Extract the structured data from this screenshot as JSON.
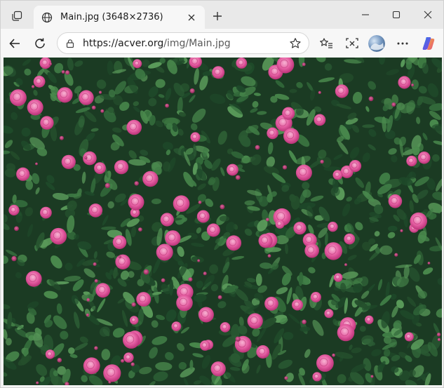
{
  "window": {
    "tab": {
      "title": "Main.jpg (3648×2736)"
    },
    "address": {
      "host": "https://acver.org",
      "path": "/img/Main.jpg"
    }
  },
  "image": {
    "subject": "rose-bush",
    "colors": {
      "foliage_dark": "#1a3a22",
      "foliage_mid": "#2f5f35",
      "leaf_light": "#4d8a4f",
      "rose_pink": "#e45aa0",
      "rose_light": "#f39ac4",
      "rose_deep": "#c93f84"
    }
  },
  "colors": {
    "tabbar_bg": "#e9e9e9",
    "toolbar_bg": "#f7f7f7",
    "accent": "#0f6cbd"
  }
}
